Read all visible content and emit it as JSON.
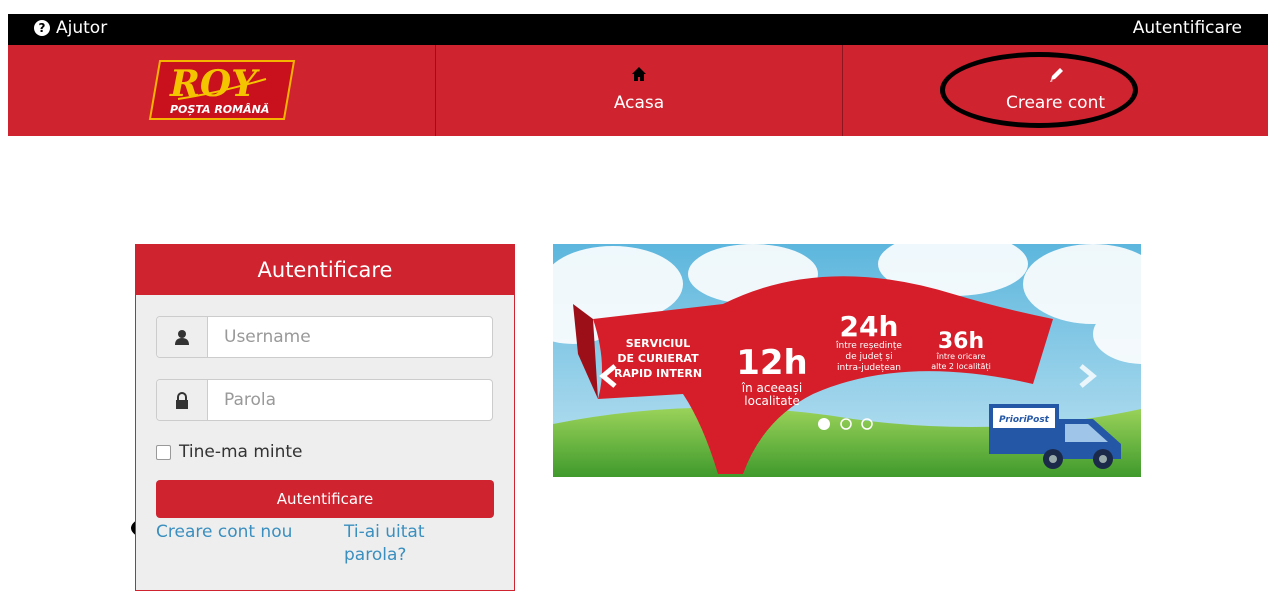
{
  "topbar": {
    "help_label": "Ajutor",
    "help_icon": "question-circle-icon",
    "login_label": "Autentificare"
  },
  "logo": {
    "brand_text": "ROY",
    "subtitle": "POȘTA ROMÂNĂ"
  },
  "nav": {
    "home_label": "Acasa",
    "home_icon": "home-icon",
    "create_label": "Creare cont",
    "create_icon": "pencil-icon"
  },
  "login": {
    "title": "Autentificare",
    "username_placeholder": "Username",
    "password_placeholder": "Parola",
    "remember_label": "Tine-ma minte",
    "submit_label": "Autentificare",
    "create_link": "Creare cont nou",
    "forgot_link_line1": "Ti-ai uitat",
    "forgot_link_line2": "parola?"
  },
  "banner": {
    "service_line1": "SERVICIUL",
    "service_line2": "DE CURIERAT",
    "service_line3": "RAPID INTERN",
    "h12": "12h",
    "h12_line1": "în aceeași",
    "h12_line2": "localitate",
    "h24": "24h",
    "h24_line1": "între reședințe",
    "h24_line2": "de județ și",
    "h24_line3": "intra-județean",
    "h36": "36h",
    "h36_line1": "între oricare",
    "h36_line2": "alte 2 localități",
    "truck_brand": "PrioriPost"
  },
  "colors": {
    "brand_red": "#cf2330",
    "link_blue": "#3a8fbf",
    "top_black": "#000000"
  }
}
